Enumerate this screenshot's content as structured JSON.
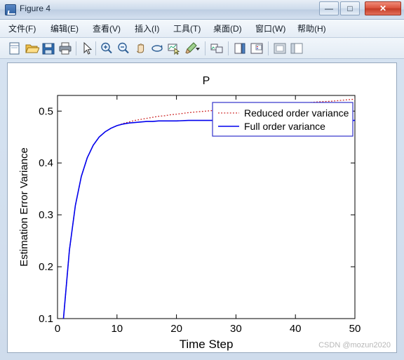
{
  "window": {
    "title": "Figure 4",
    "icon": "matlab-figure-icon",
    "buttons": {
      "minimize": "—",
      "maximize": "□",
      "close": "✕"
    }
  },
  "menubar": {
    "items": [
      {
        "label": "文件(F)",
        "name": "menu-file"
      },
      {
        "label": "编辑(E)",
        "name": "menu-edit"
      },
      {
        "label": "查看(V)",
        "name": "menu-view"
      },
      {
        "label": "插入(I)",
        "name": "menu-insert"
      },
      {
        "label": "工具(T)",
        "name": "menu-tools"
      },
      {
        "label": "桌面(D)",
        "name": "menu-desktop"
      },
      {
        "label": "窗口(W)",
        "name": "menu-window"
      },
      {
        "label": "帮助(H)",
        "name": "menu-help"
      }
    ]
  },
  "toolbar": {
    "items": [
      {
        "name": "new-figure-icon"
      },
      {
        "name": "open-folder-icon"
      },
      {
        "name": "save-icon"
      },
      {
        "name": "print-icon"
      },
      {
        "name": "pointer-icon"
      },
      {
        "name": "zoom-in-icon"
      },
      {
        "name": "zoom-out-icon"
      },
      {
        "name": "pan-icon"
      },
      {
        "name": "rotate-3d-icon"
      },
      {
        "name": "data-cursor-icon"
      },
      {
        "name": "brush-icon"
      },
      {
        "name": "link-data-icon"
      },
      {
        "name": "insert-colorbar-icon"
      },
      {
        "name": "insert-legend-icon"
      },
      {
        "name": "hide-plot-tools-icon"
      },
      {
        "name": "show-plot-tools-icon"
      }
    ]
  },
  "watermark": "CSDN @mozun2020",
  "chart_data": {
    "type": "line",
    "title": "P",
    "xlabel": "Time Step",
    "ylabel": "Estimation Error Variance",
    "xlim": [
      0,
      50
    ],
    "ylim": [
      0.1,
      0.53
    ],
    "xticks": [
      0,
      10,
      20,
      30,
      40,
      50
    ],
    "xticklabels": [
      "0",
      "10",
      "20",
      "30",
      "40",
      "50"
    ],
    "yticks": [
      0.1,
      0.2,
      0.3,
      0.4,
      0.5
    ],
    "yticklabels": [
      "0.1",
      "0.2",
      "0.3",
      "0.4",
      "0.5"
    ],
    "grid": false,
    "legend": {
      "position": "top-right",
      "entries": [
        {
          "label": "Reduced order variance",
          "color": "#cc2222",
          "style": "dotted"
        },
        {
          "label": "Full order variance",
          "color": "#0000ee",
          "style": "solid"
        }
      ]
    },
    "series": [
      {
        "name": "Reduced order variance",
        "color": "#cc2222",
        "style": "dotted",
        "x": [
          1,
          2,
          3,
          4,
          5,
          6,
          7,
          8,
          9,
          10,
          11,
          12,
          13,
          14,
          15,
          16,
          17,
          18,
          19,
          20,
          22,
          24,
          26,
          28,
          30,
          32,
          34,
          36,
          38,
          40,
          42,
          44,
          46,
          48,
          50
        ],
        "y": [
          0.1,
          0.232,
          0.318,
          0.374,
          0.41,
          0.434,
          0.45,
          0.46,
          0.467,
          0.472,
          0.476,
          0.479,
          0.482,
          0.484,
          0.486,
          0.488,
          0.49,
          0.491,
          0.493,
          0.494,
          0.497,
          0.499,
          0.501,
          0.503,
          0.505,
          0.507,
          0.509,
          0.511,
          0.512,
          0.514,
          0.516,
          0.518,
          0.519,
          0.521,
          0.523
        ]
      },
      {
        "name": "Full order variance",
        "color": "#0000ee",
        "style": "solid",
        "x": [
          1,
          2,
          3,
          4,
          5,
          6,
          7,
          8,
          9,
          10,
          11,
          12,
          13,
          14,
          15,
          16,
          17,
          18,
          19,
          20,
          22,
          24,
          26,
          28,
          30,
          32,
          34,
          36,
          38,
          40,
          42,
          44,
          46,
          48,
          50
        ],
        "y": [
          0.1,
          0.232,
          0.318,
          0.374,
          0.41,
          0.434,
          0.45,
          0.46,
          0.467,
          0.472,
          0.475,
          0.477,
          0.478,
          0.479,
          0.48,
          0.48,
          0.481,
          0.481,
          0.481,
          0.481,
          0.482,
          0.482,
          0.482,
          0.482,
          0.482,
          0.482,
          0.482,
          0.482,
          0.482,
          0.482,
          0.482,
          0.482,
          0.482,
          0.482,
          0.482
        ]
      }
    ]
  }
}
